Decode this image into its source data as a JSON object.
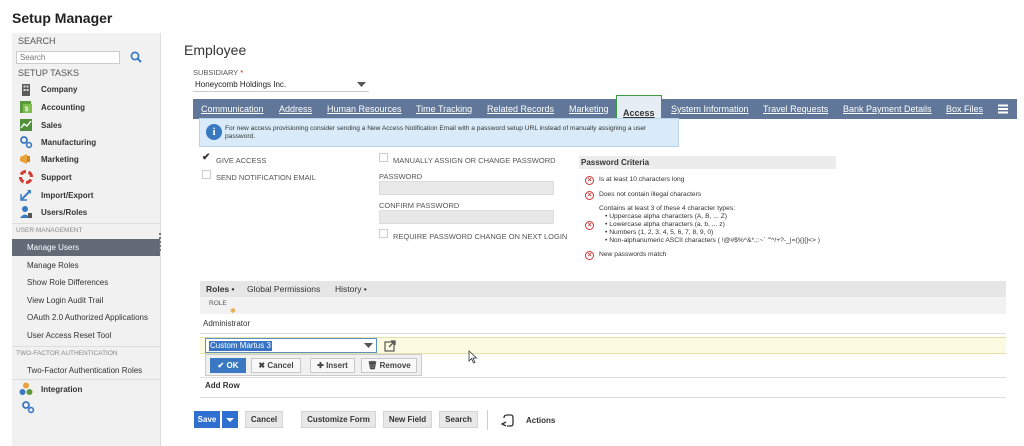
{
  "app": {
    "title": "Setup Manager"
  },
  "sidebar": {
    "search_label": "SEARCH",
    "search_placeholder": "Search",
    "setup_tasks_label": "SETUP TASKS",
    "items": [
      {
        "label": "Company",
        "icon": "building-icon"
      },
      {
        "label": "Accounting",
        "icon": "ledger-icon"
      },
      {
        "label": "Sales",
        "icon": "chart-icon"
      },
      {
        "label": "Manufacturing",
        "icon": "gears-icon"
      },
      {
        "label": "Marketing",
        "icon": "megaphone-icon"
      },
      {
        "label": "Support",
        "icon": "lifebuoy-icon"
      },
      {
        "label": "Import/Export",
        "icon": "arrows-icon"
      },
      {
        "label": "Users/Roles",
        "icon": "user-icon"
      }
    ],
    "user_management_header": "USER MANAGEMENT",
    "user_management": [
      "Manage Users",
      "Manage Roles",
      "Show Role Differences",
      "View Login Audit Trail",
      "OAuth 2.0 Authorized Applications",
      "User Access Reset Tool"
    ],
    "active_item": "Manage Users",
    "two_factor_header": "TWO-FACTOR AUTHENTICATION",
    "two_factor": [
      "Two-Factor Authentication Roles"
    ],
    "integration_label": "Integration"
  },
  "page": {
    "heading": "Employee",
    "subsidiary_label": "SUBSIDIARY",
    "subsidiary_required": "*",
    "subsidiary_value": "Honeycomb Holdings Inc."
  },
  "tabs": [
    "Communication",
    "Address",
    "Human Resources",
    "Time Tracking",
    "Related Records",
    "Marketing",
    "Access",
    "System Information",
    "Travel Requests",
    "Bank Payment Details",
    "Box Files"
  ],
  "active_tab": "Access",
  "banner": {
    "text": "For new access provisioning consider sending a New Access Notification Email with a password setup URL instead of manually assigning a user password."
  },
  "access": {
    "give_access": "GIVE ACCESS",
    "give_access_checked": true,
    "send_notification": "SEND NOTIFICATION EMAIL",
    "manually_assign": "MANUALLY ASSIGN OR CHANGE PASSWORD",
    "password_label": "PASSWORD",
    "confirm_password_label": "CONFIRM PASSWORD",
    "require_change": "REQUIRE PASSWORD CHANGE ON NEXT LOGIN"
  },
  "criteria": {
    "title": "Password Criteria",
    "items": [
      "Is at least 10 characters long",
      "Does not contain illegal characters"
    ],
    "types_intro": "Contains at least 3 of these 4 character types:",
    "types": [
      "• Uppercase alpha characters (A, B, ... Z)",
      "• Lowercase alpha characters (a, b, ... z)",
      "• Numbers (1, 2, 3, 4, 5, 6, 7, 8, 9, 0)",
      "• Non-alphanumeric ASCII characters ( !@#$%^&*.;:~` \"'^/+?-_|=(){}[]<> )"
    ],
    "match": "New passwords match"
  },
  "roles": {
    "subtabs": [
      "Roles •",
      "Global Permissions",
      "History •"
    ],
    "column": "ROLE",
    "rows": [
      "Administrator"
    ],
    "editing_value": "Custom Martus 3",
    "ok": "OK",
    "cancel": "Cancel",
    "insert": "Insert",
    "remove": "Remove",
    "add_row": "Add Row"
  },
  "footer": {
    "save": "Save",
    "cancel": "Cancel",
    "customize_form": "Customize Form",
    "new_field": "New Field",
    "search": "Search",
    "actions": "Actions"
  }
}
